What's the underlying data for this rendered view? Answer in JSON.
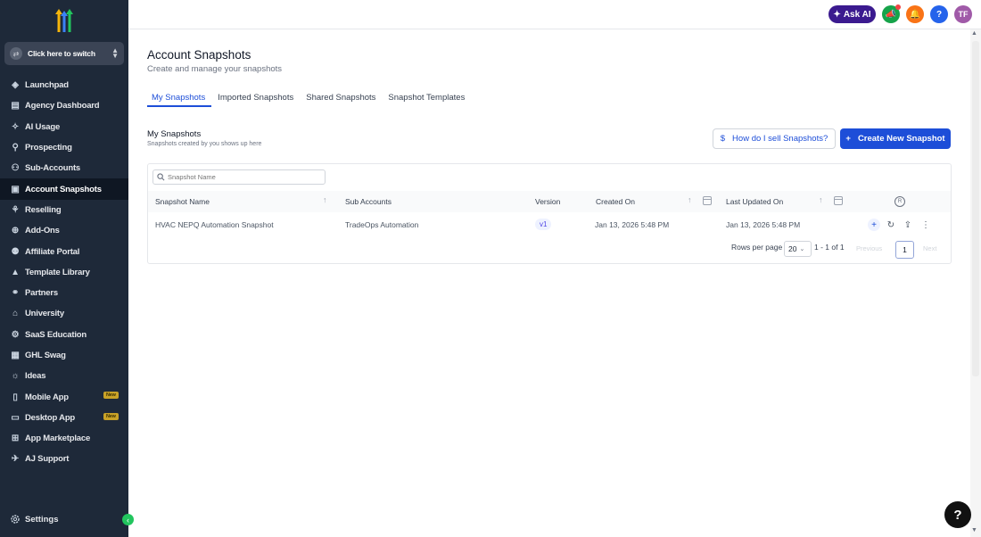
{
  "sidebar": {
    "switcher_label": "Click here to switch",
    "items": [
      {
        "label": "Launchpad",
        "icon": "rocket-icon"
      },
      {
        "label": "Agency Dashboard",
        "icon": "dashboard-icon"
      },
      {
        "label": "AI Usage",
        "icon": "sparkle-icon"
      },
      {
        "label": "Prospecting",
        "icon": "prospecting-icon"
      },
      {
        "label": "Sub-Accounts",
        "icon": "user-icon"
      },
      {
        "label": "Account Snapshots",
        "icon": "snapshot-icon",
        "active": true
      },
      {
        "label": "Reselling",
        "icon": "reselling-icon"
      },
      {
        "label": "Add-Ons",
        "icon": "addons-icon"
      },
      {
        "label": "Affiliate Portal",
        "icon": "users-icon"
      },
      {
        "label": "Template Library",
        "icon": "library-icon"
      },
      {
        "label": "Partners",
        "icon": "handshake-icon"
      },
      {
        "label": "University",
        "icon": "graduation-icon"
      },
      {
        "label": "SaaS Education",
        "icon": "education-icon"
      },
      {
        "label": "GHL Swag",
        "icon": "swag-icon"
      },
      {
        "label": "Ideas",
        "icon": "lightbulb-icon"
      },
      {
        "label": "Mobile App",
        "icon": "mobile-icon",
        "badge": "New"
      },
      {
        "label": "Desktop App",
        "icon": "desktop-icon",
        "badge": "New"
      },
      {
        "label": "App Marketplace",
        "icon": "grid-icon"
      },
      {
        "label": "AJ Support",
        "icon": "support-icon"
      }
    ],
    "settings_label": "Settings"
  },
  "header": {
    "ask_ai_label": "Ask AI",
    "help_label": "?",
    "avatar_initials": "TF"
  },
  "main": {
    "title": "Account Snapshots",
    "subtitle": "Create and manage your snapshots",
    "tabs": [
      {
        "label": "My Snapshots",
        "active": true
      },
      {
        "label": "Imported Snapshots"
      },
      {
        "label": "Shared Snapshots"
      },
      {
        "label": "Snapshot Templates"
      }
    ],
    "section_title": "My Snapshots",
    "section_subtitle": "Snapshots created by you shows up here",
    "help_button_label": "How do I sell Snapshots?",
    "help_button_icon": "$",
    "create_button_label": "Create New Snapshot",
    "create_button_icon": "+",
    "search_placeholder": "Snapshot Name",
    "table": {
      "columns": [
        "Snapshot Name",
        "Sub Accounts",
        "Version",
        "Created On",
        "Last Updated On"
      ],
      "rows": [
        {
          "name": "HVAC NEPQ Automation Snapshot",
          "sub_accounts": "TradeOps Automation",
          "version": "v1",
          "created_on": "Jan 13, 2026 5:48 PM",
          "last_updated_on": "Jan 13, 2026 5:48 PM"
        }
      ]
    },
    "pagination": {
      "rows_per_page_label": "Rows per page",
      "rows_per_page": "20",
      "range": "1 - 1 of 1",
      "previous_label": "Previous",
      "current_page": "1",
      "next_label": "Next"
    }
  },
  "fab_label": "?",
  "colors": {
    "sidebar_bg": "#1e2939",
    "primary": "#1d4ed8",
    "ask_ai": "#3b1a8f",
    "badge_new": "#c9a227"
  }
}
